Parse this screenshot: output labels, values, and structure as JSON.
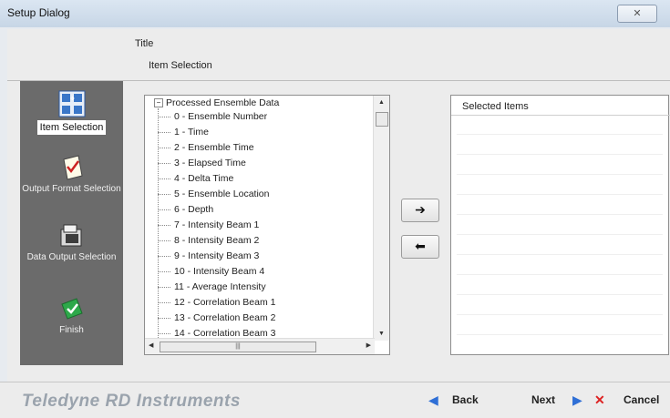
{
  "window": {
    "title": "Setup Dialog",
    "close_glyph": "✕"
  },
  "header": {
    "title": "Title",
    "subtitle": "Item Selection"
  },
  "sidebar": {
    "items": [
      {
        "label": "Item Selection",
        "icon": "item-selection-icon"
      },
      {
        "label": "Output Format Selection",
        "icon": "checklist-icon"
      },
      {
        "label": "Data Output Selection",
        "icon": "folder-data-icon"
      },
      {
        "label": "Finish",
        "icon": "finish-icon"
      }
    ]
  },
  "tree": {
    "root": "Processed Ensemble Data",
    "items": [
      "0 - Ensemble Number",
      "1 - Time",
      "2 - Ensemble Time",
      "3 - Elapsed Time",
      "4 - Delta Time",
      "5 - Ensemble Location",
      "6 - Depth",
      "7 - Intensity Beam 1",
      "8 - Intensity Beam 2",
      "9 - Intensity Beam 3",
      "10 - Intensity Beam 4",
      "11 - Average Intensity",
      "12 - Correlation Beam 1",
      "13 - Correlation Beam 2",
      "14 - Correlation Beam 3"
    ]
  },
  "buttons": {
    "add_glyph": "➔",
    "remove_glyph": "⬅"
  },
  "selected": {
    "header": "Selected Items"
  },
  "footer": {
    "brand": "Teledyne RD Instruments",
    "back": "Back",
    "next": "Next",
    "cancel": "Cancel"
  },
  "colors": {
    "sidebar_bg": "#6b6b6b",
    "arrow_blue": "#2f6fd6",
    "cancel_red": "#d22"
  }
}
